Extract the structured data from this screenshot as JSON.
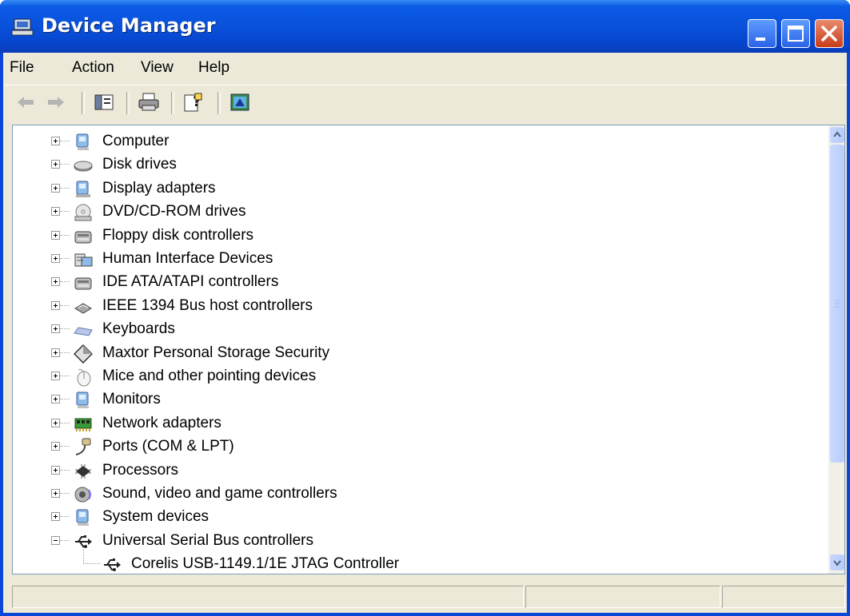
{
  "window": {
    "title": "Device Manager"
  },
  "menu": {
    "file": "File",
    "action": "Action",
    "view": "View",
    "help": "Help"
  },
  "toolbar": {
    "icons": [
      "back-arrow-icon",
      "forward-arrow-icon",
      "show-hide-console-tree-icon",
      "print-icon",
      "properties-help-icon",
      "update-driver-icon"
    ]
  },
  "tree": {
    "categories": [
      {
        "label": "Computer",
        "icon": "computer-icon",
        "expanded": false
      },
      {
        "label": "Disk drives",
        "icon": "disk-drive-icon",
        "expanded": false
      },
      {
        "label": "Display adapters",
        "icon": "display-adapter-icon",
        "expanded": false
      },
      {
        "label": "DVD/CD-ROM drives",
        "icon": "cd-drive-icon",
        "expanded": false
      },
      {
        "label": "Floppy disk controllers",
        "icon": "controller-icon",
        "expanded": false
      },
      {
        "label": "Human Interface Devices",
        "icon": "hid-icon",
        "expanded": false
      },
      {
        "label": "IDE ATA/ATAPI controllers",
        "icon": "controller-icon",
        "expanded": false
      },
      {
        "label": "IEEE 1394 Bus host controllers",
        "icon": "ieee1394-icon",
        "expanded": false
      },
      {
        "label": "Keyboards",
        "icon": "keyboard-icon",
        "expanded": false
      },
      {
        "label": "Maxtor Personal Storage Security",
        "icon": "diamond-icon",
        "expanded": false
      },
      {
        "label": "Mice and other pointing devices",
        "icon": "mouse-icon",
        "expanded": false
      },
      {
        "label": "Monitors",
        "icon": "monitor-icon",
        "expanded": false
      },
      {
        "label": "Network adapters",
        "icon": "network-adapter-icon",
        "expanded": false
      },
      {
        "label": "Ports (COM & LPT)",
        "icon": "port-icon",
        "expanded": false
      },
      {
        "label": "Processors",
        "icon": "processor-icon",
        "expanded": false
      },
      {
        "label": "Sound, video and game controllers",
        "icon": "speaker-icon",
        "expanded": false
      },
      {
        "label": "System devices",
        "icon": "computer-icon",
        "expanded": false
      },
      {
        "label": "Universal Serial Bus controllers",
        "icon": "usb-icon",
        "expanded": true
      }
    ],
    "usb_children": [
      {
        "label": "Corelis USB-1149.1/1E JTAG Controller",
        "icon": "usb-icon"
      }
    ]
  },
  "colors": {
    "titlebar": "#0a52dc",
    "chrome": "#ece9d8",
    "close_button": "#c93d1a",
    "scrollbar": "#b8cdfa"
  }
}
